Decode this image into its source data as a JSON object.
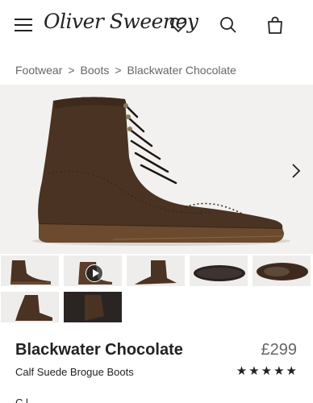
{
  "header": {
    "brand": "Oliver Sweeney",
    "menu_icon": "hamburger-menu-icon",
    "wishlist_icon": "heart-icon",
    "search_icon": "search-icon",
    "bag_icon": "shopping-bag-icon"
  },
  "breadcrumb": {
    "items": [
      "Footwear",
      "Boots",
      "Blackwater Chocolate"
    ],
    "separator": ">"
  },
  "gallery": {
    "next_icon": "chevron-right-icon",
    "play_icon": "play-icon",
    "thumbnail_count": 7
  },
  "product": {
    "name": "Blackwater Chocolate",
    "price": "£299",
    "description": "Calf Suede Brogue Boots",
    "rating": 5,
    "rating_max": 5,
    "next_section_label": "C l"
  },
  "colors": {
    "suede": "#4a3322",
    "sole": "#6b4a2e",
    "text": "#222222",
    "muted": "#666666"
  }
}
